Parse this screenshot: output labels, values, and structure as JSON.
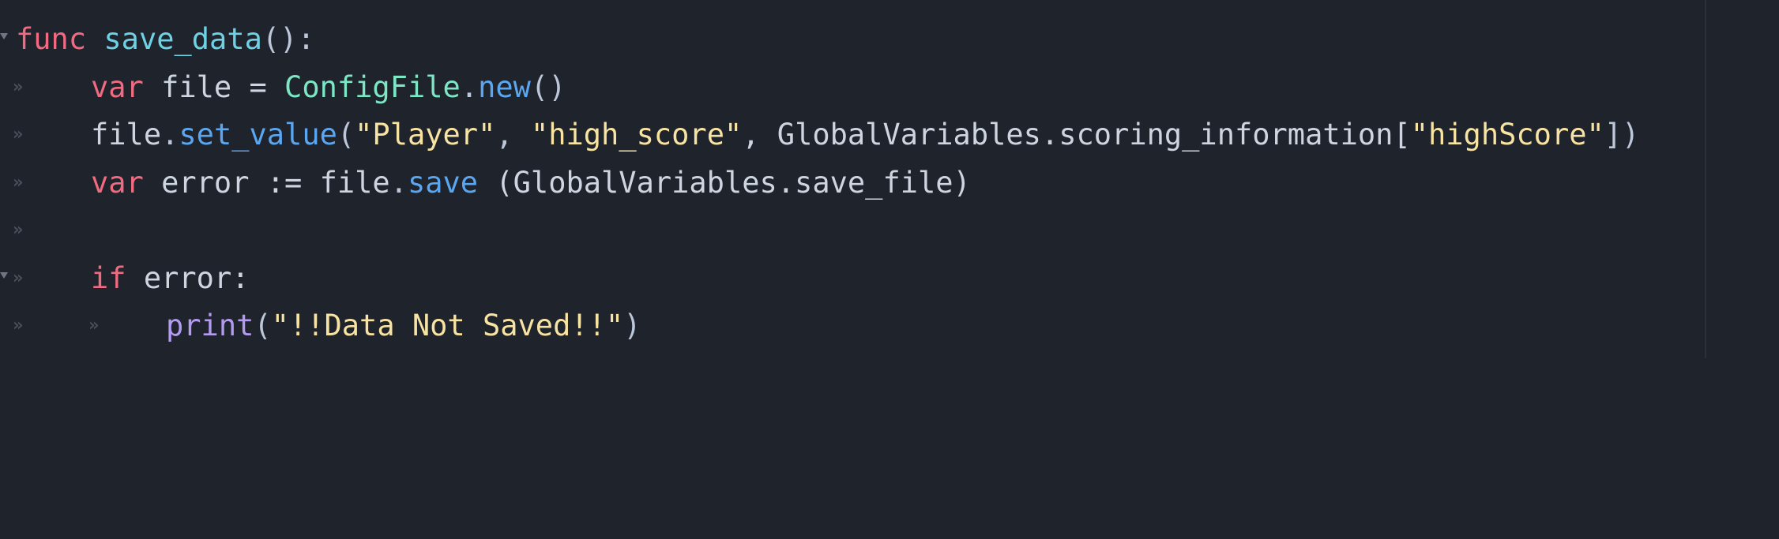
{
  "editor": {
    "lines": [
      {
        "tokens": [
          "func",
          " ",
          "save_data",
          "():"
        ]
      },
      {
        "tokens": [
          "var",
          " file = ",
          "ConfigFile",
          ".",
          "new",
          "()"
        ]
      },
      {
        "tokens": [
          "file",
          ".",
          "set_value",
          "(",
          "\"Player\"",
          ", ",
          "\"high_score\"",
          ", GlobalVariables.scoring_information[",
          "\"highScore\"",
          "])"
        ]
      },
      {
        "tokens": [
          "var",
          " error := file",
          ".",
          "save",
          " (GlobalVariables.save_file)"
        ]
      },
      {
        "tokens": []
      },
      {
        "tokens": [
          "if",
          " error:"
        ]
      },
      {
        "tokens": [
          "print",
          "(",
          "\"!!Data Not Saved!!\"",
          ")"
        ]
      }
    ],
    "tab_marker_glyph": "»"
  },
  "colors": {
    "background": "#1f232b",
    "keyword": "#f06b82",
    "function_name": "#6fd2e4",
    "type": "#7ce6c5",
    "method": "#5aa6f0",
    "string": "#f7e3a2",
    "builtin": "#b39cf0",
    "identifier": "#ced4e0"
  },
  "icons": {
    "fold": "chevron-down-icon",
    "tab": "tab-indent-icon"
  }
}
